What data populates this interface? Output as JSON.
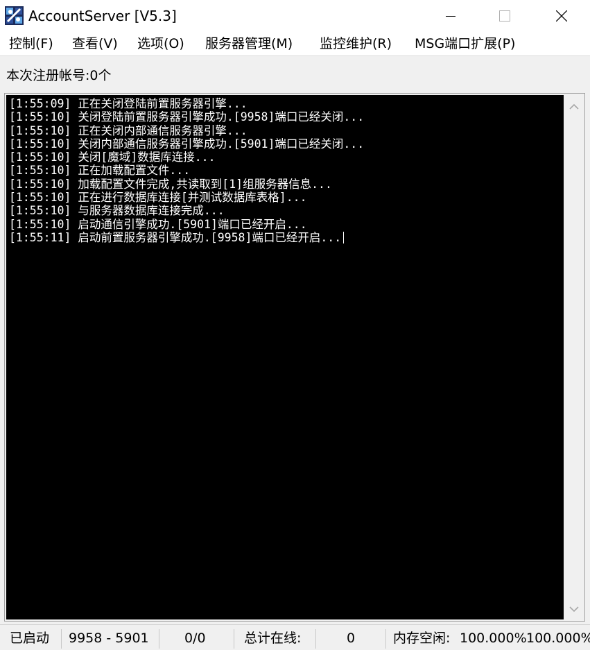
{
  "window": {
    "title": "AccountServer [V5.3]",
    "controls": {
      "minimize": "minimize-icon",
      "maximize": "maximize-icon",
      "close": "close-icon"
    }
  },
  "menu": {
    "items": [
      "控制(F)",
      "查看(V)",
      "选项(O)",
      "服务器管理(M)",
      "监控维护(R)",
      "MSG端口扩展(P)"
    ]
  },
  "info": {
    "registered_accounts": "本次注册帐号:0个"
  },
  "console": {
    "lines": [
      "[1:55:09] 正在关闭登陆前置服务器引擎...",
      "[1:55:10] 关闭登陆前置服务器引擎成功.[9958]端口已经关闭...",
      "[1:55:10] 正在关闭内部通信服务器引擎...",
      "[1:55:10] 关闭内部通信服务器引擎成功.[5901]端口已经关闭...",
      "[1:55:10] 关闭[魔域]数据库连接...",
      "[1:55:10] 正在加载配置文件...",
      "[1:55:10] 加载配置文件完成,共读取到[1]组服务器信息...",
      "[1:55:10] 正在进行数据库连接[并测试数据库表格]...",
      "[1:55:10] 与服务器数据库连接完成...",
      "[1:55:10] 启动通信引擎成功.[5901]端口已经开启...",
      "[1:55:11] 启动前置服务器引擎成功.[9958]端口已经开启..."
    ]
  },
  "status": {
    "state": "已启动",
    "ports": "9958 - 5901",
    "counts": "0/0",
    "online_label": "总计在线:",
    "online_value": "0",
    "memory_label": "内存空闲:",
    "memory_value_1": "100.000%",
    "memory_value_2": "100.000%"
  },
  "colors": {
    "console_bg": "#000000",
    "console_fg": "#ffffff",
    "chrome_bg": "#f0f0f0"
  }
}
